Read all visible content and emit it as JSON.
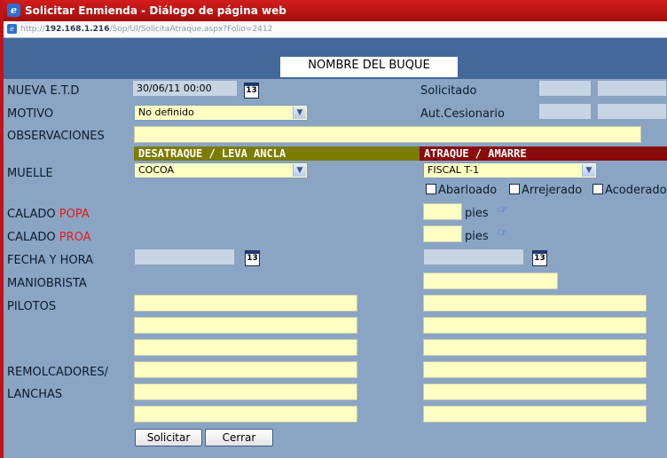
{
  "window": {
    "title": "Solicitar Enmienda - Diálogo de página web"
  },
  "address": {
    "prefix": "http://",
    "host": "192.168.1.216",
    "path": "/Sop/UI/SolicitaAtraque.aspx?Folio=2412"
  },
  "header": {
    "ship_name": "NOMBRE DEL BUQUE"
  },
  "form": {
    "nueva_etd_label": "NUEVA E.T.D",
    "nueva_etd_value": "30/06/11 00:00",
    "motivo_label": "MOTIVO",
    "motivo_value": "No definido",
    "solicitado_label": "Solicitado",
    "aut_cesionario_label": "Aut.Cesionario",
    "observaciones_label": "OBSERVACIONES",
    "muelle_label": "MUELLE",
    "calado_label": "CALADO",
    "popa": "POPA",
    "proa": "PROA",
    "fecha_hora_label": "FECHA Y HORA",
    "maniobrista_label": "MANIOBRISTA",
    "pilotos_label": "PILOTOS",
    "remolcadores_label": "REMOLCADORES/",
    "lanchas_label": "LANCHAS",
    "calendar_glyph": "13"
  },
  "left": {
    "banner": "DESATRAQUE / LEVA ANCLA",
    "muelle_value": "COCOA"
  },
  "right": {
    "banner": "ATRAQUE / AMARRE",
    "muelle_value": "FISCAL T-1",
    "checkboxes": [
      "Abarloado",
      "Arrejerado",
      "Acoderado"
    ],
    "unit": "pies"
  },
  "buttons": {
    "solicitar": "Solicitar",
    "cerrar": "Cerrar"
  },
  "colors": {
    "title_bar": "#c0141a",
    "left_banner": "#7c7c00",
    "right_banner": "#8a0b0b",
    "panel": "#8aa5c4",
    "input": "#ffffc4"
  }
}
